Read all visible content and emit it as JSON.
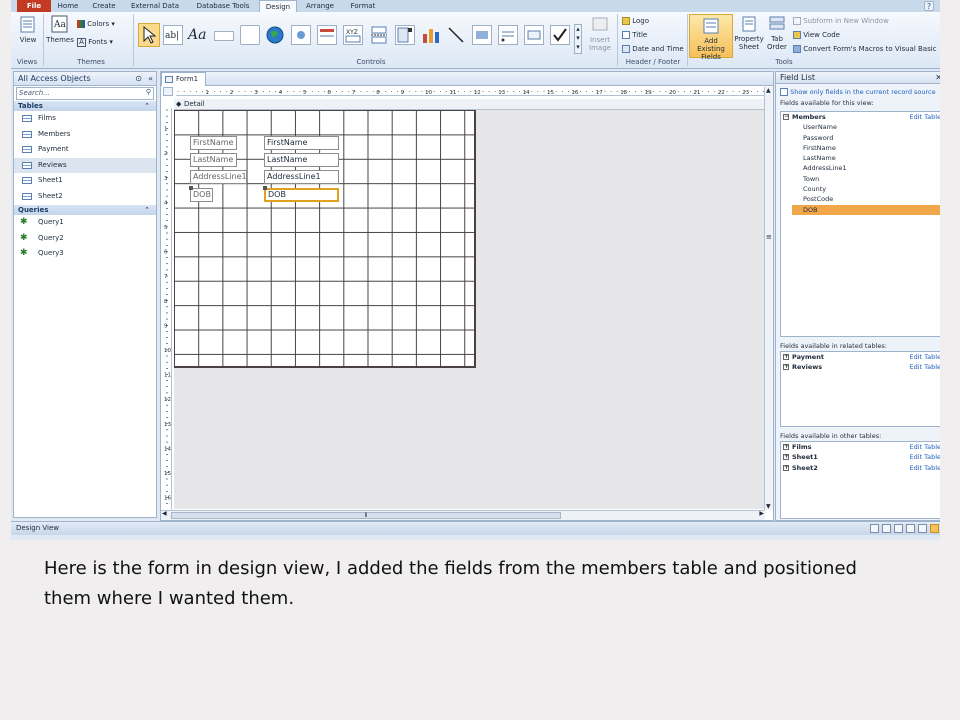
{
  "tabs": [
    "File",
    "Home",
    "Create",
    "External Data",
    "Database Tools",
    "Design",
    "Arrange",
    "Format"
  ],
  "ribbon": {
    "views": {
      "view_label": "View",
      "group": "Views"
    },
    "themes": {
      "themes_label": "Themes",
      "colors_label": "Colors",
      "fonts_label": "Fonts",
      "group": "Themes"
    },
    "controls": {
      "label_text": "Aa",
      "group": "Controls",
      "insert_image": "Insert Image"
    },
    "header_footer": {
      "logo": "Logo",
      "title": "Title",
      "date_time": "Date and Time",
      "group": "Header / Footer"
    },
    "tools": {
      "add_fields": "Add Existing Fields",
      "property_sheet": "Property Sheet",
      "tab_order": "Tab Order",
      "subform": "Subform in New Window",
      "view_code": "View Code",
      "convert_macros": "Convert Form's Macros to Visual Basic",
      "group": "Tools"
    }
  },
  "nav": {
    "title": "All Access Objects",
    "search_placeholder": "Search...",
    "tables_header": "Tables",
    "tables": [
      "Films",
      "Members",
      "Payment",
      "Reviews",
      "Sheet1",
      "Sheet2"
    ],
    "selected_table": "Reviews",
    "queries_header": "Queries",
    "queries": [
      "Query1",
      "Query2",
      "Query3"
    ]
  },
  "document": {
    "tab_title": "Form1",
    "section": "Detail",
    "ruler_numbers": [
      "1",
      "2",
      "3",
      "4",
      "5",
      "6",
      "7",
      "8",
      "9",
      "10",
      "11",
      "12",
      "13",
      "14",
      "15",
      "16",
      "17",
      "18",
      "19",
      "20",
      "21",
      "22",
      "23",
      "24"
    ],
    "vruler_numbers": [
      "1",
      "2",
      "3",
      "4",
      "5",
      "6",
      "7",
      "8",
      "9",
      "10",
      "11",
      "12",
      "13",
      "14",
      "15",
      "16"
    ],
    "labels": [
      "FirstName",
      "LastName",
      "AddressLine1",
      "DOB"
    ],
    "textboxes": [
      "FirstName",
      "LastName",
      "AddressLine1",
      "DOB"
    ]
  },
  "field_list": {
    "title": "Field List",
    "show_only": "Show only fields in the current record source",
    "available_view": "Fields available for this view:",
    "table": "Members",
    "edit_table": "Edit Table",
    "fields": [
      "UserName",
      "Password",
      "FirstName",
      "LastName",
      "AddressLine1",
      "Town",
      "County",
      "PostCode",
      "DOB"
    ],
    "selected_field": "DOB",
    "related_header": "Fields available in related tables:",
    "related": [
      "Payment",
      "Reviews"
    ],
    "other_header": "Fields available in other tables:",
    "other": [
      "Films",
      "Sheet1",
      "Sheet2"
    ]
  },
  "status": {
    "text": "Design View"
  },
  "caption": "Here is the form in design view, I added the fields from the members table and positioned them where I wanted them."
}
